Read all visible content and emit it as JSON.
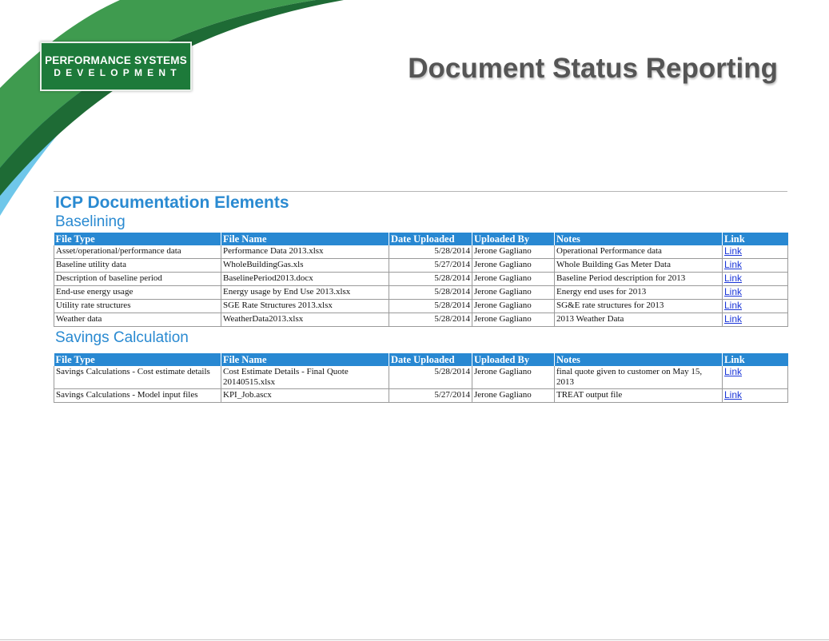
{
  "logo": {
    "line1": "PERFORMANCE SYSTEMS",
    "line2": "DEVELOPMENT"
  },
  "title": "Document Status Reporting",
  "heading": "ICP Documentation Elements",
  "columns": [
    "File Type",
    "File Name",
    "Date Uploaded",
    "Uploaded By",
    "Notes",
    "Link"
  ],
  "colors": {
    "accent": "#2888d2",
    "heading": "#2a8ad1",
    "title": "#555555",
    "logo_bg": "#1d7a3a",
    "link": "#1a35d8"
  },
  "icons": [
    "performance-systems-logo",
    "decorative-swoosh"
  ],
  "sections": [
    {
      "title": "Baselining",
      "rows": [
        {
          "file_type": "Asset/operational/performance data",
          "file_name": "Performance Data 2013.xlsx",
          "date": "5/28/2014",
          "uploaded_by": "Jerone Gagliano",
          "notes": "Operational Performance data",
          "link": "Link"
        },
        {
          "file_type": "Baseline utility data",
          "file_name": "WholeBuildingGas.xls",
          "date": "5/27/2014",
          "uploaded_by": "Jerone Gagliano",
          "notes": "Whole Building Gas Meter Data",
          "link": "Link"
        },
        {
          "file_type": "Description of baseline period",
          "file_name": "BaselinePeriod2013.docx",
          "date": "5/28/2014",
          "uploaded_by": "Jerone Gagliano",
          "notes": "Baseline Period description for 2013",
          "link": "Link"
        },
        {
          "file_type": "End-use energy usage",
          "file_name": "Energy usage by End Use 2013.xlsx",
          "date": "5/28/2014",
          "uploaded_by": "Jerone Gagliano",
          "notes": "Energy end uses for 2013",
          "link": "Link"
        },
        {
          "file_type": "Utility rate structures",
          "file_name": "SGE Rate Structures 2013.xlsx",
          "date": "5/28/2014",
          "uploaded_by": "Jerone Gagliano",
          "notes": "SG&E rate structures for 2013",
          "link": "Link"
        },
        {
          "file_type": "Weather data",
          "file_name": "WeatherData2013.xlsx",
          "date": "5/28/2014",
          "uploaded_by": "Jerone Gagliano",
          "notes": "2013 Weather Data",
          "link": "Link"
        }
      ]
    },
    {
      "title": "Savings Calculation",
      "rows": [
        {
          "file_type": "Savings Calculations - Cost estimate details",
          "file_name": "Cost Estimate Details - Final Quote 20140515.xlsx",
          "date": "5/28/2014",
          "uploaded_by": "Jerone Gagliano",
          "notes": "final quote given to customer on May 15, 2013",
          "link": "Link"
        },
        {
          "file_type": "Savings Calculations - Model input files",
          "file_name": "KPI_Job.ascx",
          "date": "5/27/2014",
          "uploaded_by": "Jerone Gagliano",
          "notes": "TREAT output file",
          "link": "Link"
        }
      ]
    }
  ]
}
